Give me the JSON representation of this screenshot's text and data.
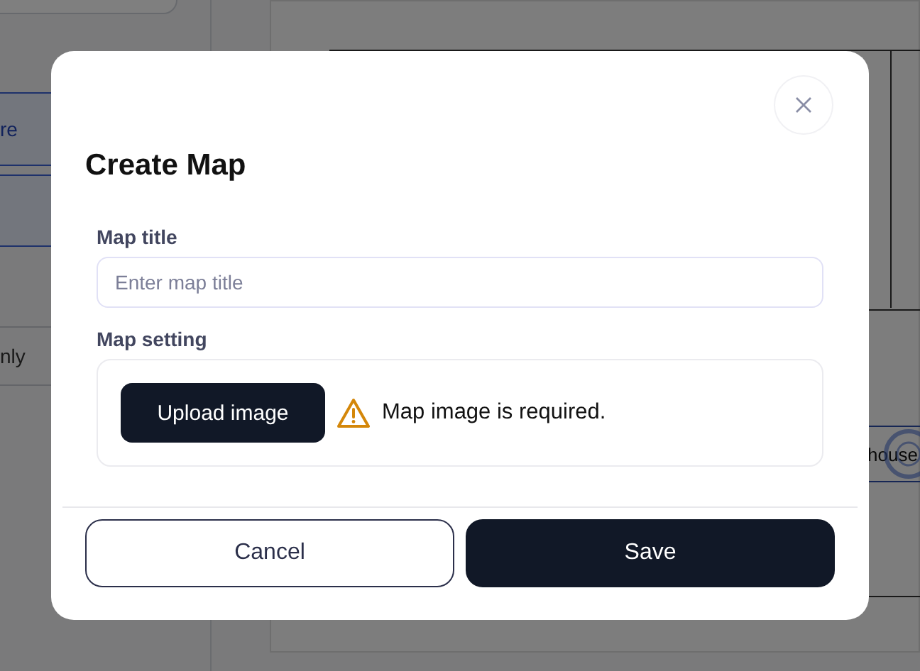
{
  "background": {
    "sidebar_items": [
      {
        "label": "re",
        "selected": true
      },
      {
        "selected": true
      },
      {
        "label": "nly",
        "selected": false
      }
    ],
    "canvas_label": "house"
  },
  "dialog": {
    "title": "Create Map",
    "fields": [
      {
        "kind": "text",
        "label": "Map title",
        "placeholder": "Enter map title"
      },
      {
        "kind": "upload",
        "label": "Map setting",
        "button": "Upload image",
        "error": "Map image is required."
      }
    ],
    "buttons": [
      {
        "label": "Cancel",
        "kind": "secondary"
      },
      {
        "label": "Save",
        "kind": "primary"
      }
    ]
  }
}
